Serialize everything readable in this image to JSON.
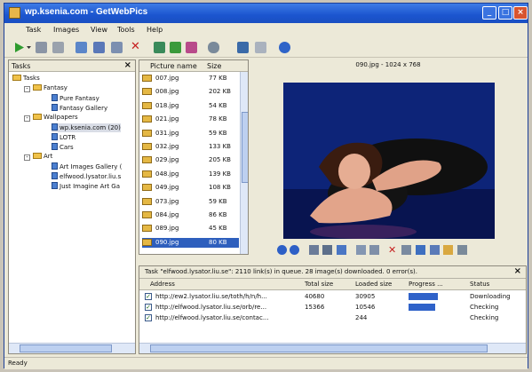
{
  "window": {
    "title": "wp.ksenia.com - GetWebPics"
  },
  "menu": [
    "Task",
    "Images",
    "View",
    "Tools",
    "Help"
  ],
  "toolbar_icons": [
    "play-icon",
    "dropdown-arrow-icon",
    "pause-icon",
    "stop-icon",
    "new-task-icon",
    "edit-task-icon",
    "delete-icon",
    "move-up-icon",
    "move-down-icon",
    "remove-icon",
    "refresh-icon",
    "settings-icon",
    "options-icon",
    "help-icon"
  ],
  "tasks_panel": {
    "title": "Tasks",
    "tree": [
      {
        "label": "Tasks",
        "type": "folder"
      },
      {
        "label": "Fantasy",
        "type": "folder"
      },
      {
        "label": "Pure Fantasy",
        "type": "page"
      },
      {
        "label": "Fantasy Gallery",
        "type": "page"
      },
      {
        "label": "Wallpapers",
        "type": "folder"
      },
      {
        "label": "wp.ksenia.com (20)",
        "type": "page"
      },
      {
        "label": "LOTR",
        "type": "page"
      },
      {
        "label": "Cars",
        "type": "page"
      },
      {
        "label": "Art",
        "type": "folder"
      },
      {
        "label": "Art Images Gallery (",
        "type": "page"
      },
      {
        "label": "elfwood.lysator.liu.s",
        "type": "page"
      },
      {
        "label": "Just Imagine Art Ga",
        "type": "page"
      }
    ]
  },
  "file_list": {
    "col_name": "Picture name",
    "col_size": "Size",
    "files": [
      {
        "name": "007.jpg",
        "size": "77 KB"
      },
      {
        "name": "008.jpg",
        "size": "202 KB"
      },
      {
        "name": "018.jpg",
        "size": "54 KB"
      },
      {
        "name": "021.jpg",
        "size": "78 KB"
      },
      {
        "name": "031.jpg",
        "size": "59 KB"
      },
      {
        "name": "032.jpg",
        "size": "133 KB"
      },
      {
        "name": "029.jpg",
        "size": "205 KB"
      },
      {
        "name": "048.jpg",
        "size": "139 KB"
      },
      {
        "name": "049.jpg",
        "size": "108 KB"
      },
      {
        "name": "073.jpg",
        "size": "59 KB"
      },
      {
        "name": "084.jpg",
        "size": "86 KB"
      },
      {
        "name": "089.jpg",
        "size": "45 KB"
      },
      {
        "name": "090.jpg",
        "size": "80 KB"
      }
    ]
  },
  "preview": {
    "caption": "090.jpg - 1024 x 768"
  },
  "preview_controls": [
    "first-icon",
    "next-icon",
    "fit-icon",
    "move-icon",
    "save-icon",
    "zoom-in-icon",
    "zoom-out-icon",
    "delete-icon",
    "print-icon",
    "copy-icon",
    "wallpaper-icon",
    "folder-icon",
    "settings-icon"
  ],
  "queue": {
    "status": "Task \"elfwood.lysator.liu.se\":   2110 link(s) in queue.   28 image(s) downloaded.   0 error(s).",
    "headers": {
      "address": "Address",
      "total": "Total size",
      "loaded": "Loaded size",
      "progress": "Progress ...",
      "status": "Status"
    },
    "rows": [
      {
        "address": "http://ew2.lysator.liu.se/toth/h/n/h...",
        "total": "40680",
        "loaded": "30905",
        "progress": 0.76,
        "status": "Downloading"
      },
      {
        "address": "http://elfwood.lysator.liu.se/orb/re...",
        "total": "15366",
        "loaded": "10546",
        "progress": 0.69,
        "status": "Checking"
      },
      {
        "address": "http://elfwood.lysator.liu.se/contac...",
        "total": "",
        "loaded": "244",
        "progress": 0,
        "status": "Checking"
      }
    ]
  },
  "statusbar": {
    "text": "Ready"
  }
}
